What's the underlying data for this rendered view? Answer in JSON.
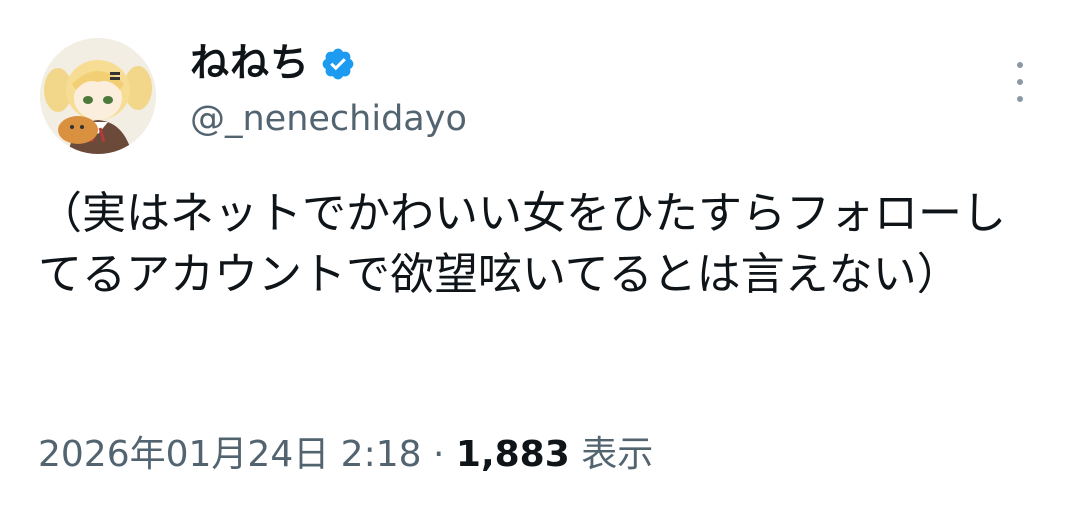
{
  "author": {
    "display_name": "ねねち",
    "handle": "@_nenechidayo",
    "avatar": "anime-girl-avatar",
    "verified_icon": "verified-badge-icon"
  },
  "menu": {
    "icon": "more-vertical-icon"
  },
  "tweet": {
    "text": "（実はネットでかわいい女をひたすらフォローしてるアカウントで欲望呟いてるとは言えない）"
  },
  "meta": {
    "timestamp": "2026年01月24日 2:18",
    "separator": "·",
    "views_count": "1,883",
    "views_label": "表示"
  },
  "colors": {
    "text": "#0f1419",
    "secondary": "#536471",
    "verified": "#1d9bf0",
    "background": "#ffffff"
  }
}
